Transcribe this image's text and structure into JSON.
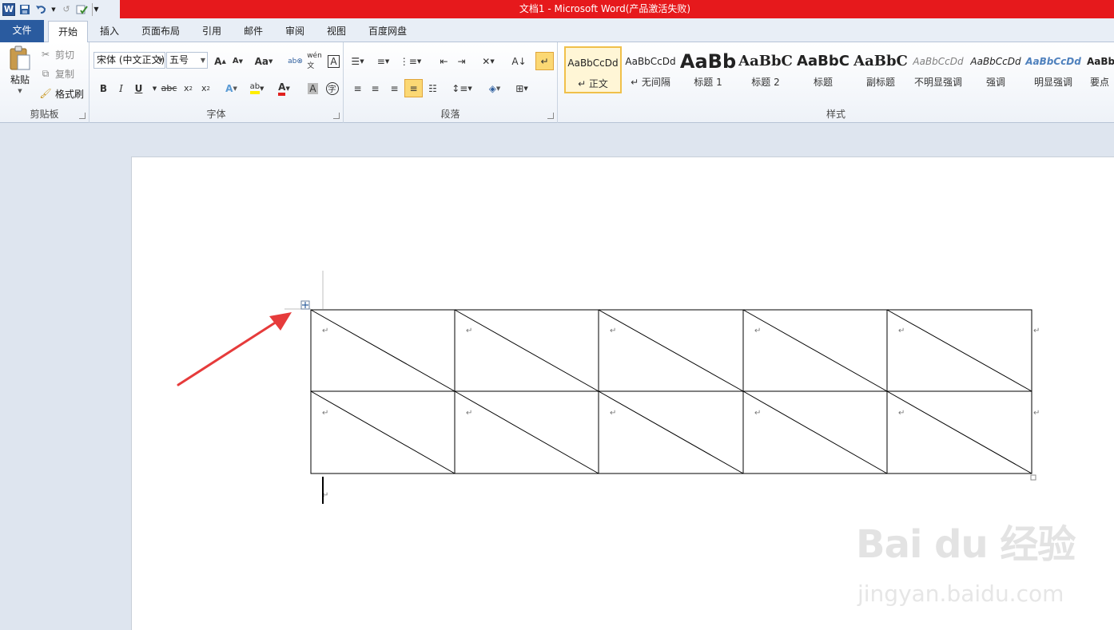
{
  "title": "文档1 - Microsoft Word(产品激活失败)",
  "quick_access": {
    "icons": [
      "word-logo-icon",
      "save-icon",
      "undo-icon",
      "redo-icon",
      "spellcheck-icon",
      "customize-icon"
    ],
    "logo_letter": "W"
  },
  "tabs": [
    {
      "label": "文件"
    },
    {
      "label": "开始"
    },
    {
      "label": "插入"
    },
    {
      "label": "页面布局"
    },
    {
      "label": "引用"
    },
    {
      "label": "邮件"
    },
    {
      "label": "审阅"
    },
    {
      "label": "视图"
    },
    {
      "label": "百度网盘"
    }
  ],
  "clipboard": {
    "label": "剪贴板",
    "paste": "粘贴",
    "cut": "剪切",
    "copy": "复制",
    "format_painter": "格式刷"
  },
  "font": {
    "label": "字体",
    "name": "宋体 (中文正文)",
    "size": "五号"
  },
  "paragraph": {
    "label": "段落"
  },
  "styles": {
    "label": "样式",
    "items": [
      {
        "preview": "AaBbCcDd",
        "name": "↵ 正文"
      },
      {
        "preview": "AaBbCcDd",
        "name": "↵ 无间隔"
      },
      {
        "preview": "AaBb",
        "name": "标题 1"
      },
      {
        "preview": "AaBbC",
        "name": "标题 2"
      },
      {
        "preview": "AaBbC",
        "name": "标题"
      },
      {
        "preview": "AaBbC",
        "name": "副标题"
      },
      {
        "preview": "AaBbCcDd",
        "name": "不明显强调"
      },
      {
        "preview": "AaBbCcDd",
        "name": "强调"
      },
      {
        "preview": "AaBbCcDd",
        "name": "明显强调"
      },
      {
        "preview": "AaBb",
        "name": "要点"
      }
    ]
  },
  "document": {
    "table": {
      "rows": 2,
      "cols": 5,
      "diagonal": true
    },
    "paragraph_mark": "↵",
    "annotation": "red-arrow-pointing-to-table-move-handle"
  },
  "watermark": {
    "logo": "Bai du 经验",
    "url": "jingyan.baidu.com"
  },
  "colors": {
    "title_bar": "#e6191c",
    "file_tab": "#2a5b9f",
    "arrow": "#e63b3b"
  }
}
